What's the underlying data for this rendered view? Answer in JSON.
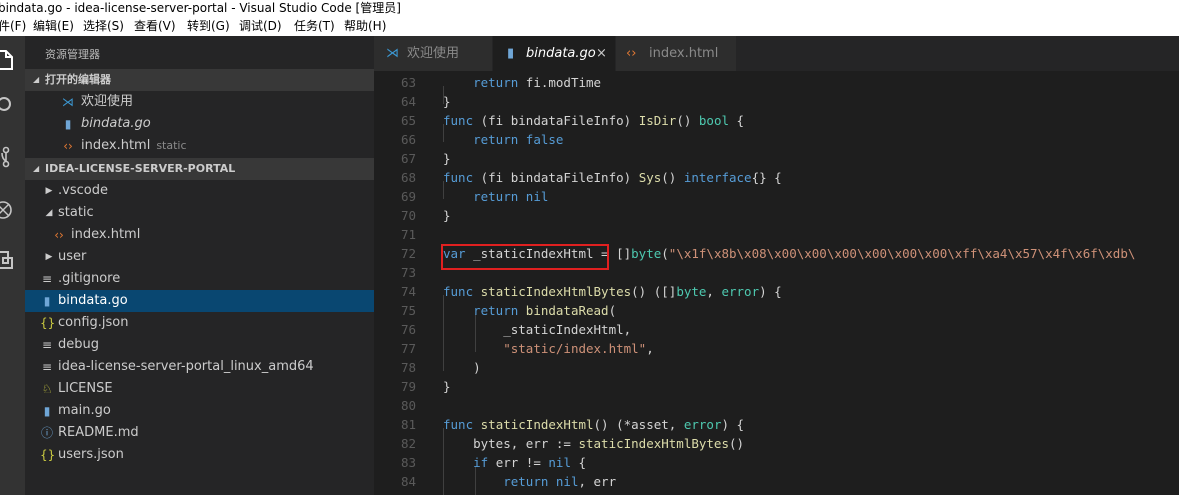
{
  "window": {
    "title": "bindata.go - idea-license-server-portal - Visual Studio Code [管理员]"
  },
  "menu": [
    "件(F)",
    "编辑(E)",
    "选择(S)",
    "查看(V)",
    "转到(G)",
    "调试(D)",
    "任务(T)",
    "帮助(H)"
  ],
  "activity_bar": [
    "files-icon",
    "search-icon",
    "source-control-icon",
    "debug-icon",
    "extensions-icon"
  ],
  "sidebar": {
    "title": "资源管理器",
    "open_editors": {
      "label": "打开的编辑器",
      "items": [
        {
          "name": "欢迎使用",
          "icon": "vscode-icon"
        },
        {
          "name": "bindata.go",
          "icon": "go-icon"
        },
        {
          "name": "index.html",
          "icon": "html-icon",
          "desc": "static"
        }
      ]
    },
    "project": {
      "label": "IDEA-LICENSE-SERVER-PORTAL",
      "items": [
        {
          "name": ".vscode",
          "type": "folder",
          "expanded": false
        },
        {
          "name": "static",
          "type": "folder",
          "expanded": true
        },
        {
          "name": "index.html",
          "type": "html"
        },
        {
          "name": "user",
          "type": "folder",
          "expanded": false
        },
        {
          "name": ".gitignore",
          "type": "file"
        },
        {
          "name": "bindata.go",
          "type": "go",
          "selected": true
        },
        {
          "name": "config.json",
          "type": "json"
        },
        {
          "name": "debug",
          "type": "file"
        },
        {
          "name": "idea-license-server-portal_linux_amd64",
          "type": "file"
        },
        {
          "name": "LICENSE",
          "type": "license"
        },
        {
          "name": "main.go",
          "type": "go"
        },
        {
          "name": "README.md",
          "type": "info"
        },
        {
          "name": "users.json",
          "type": "json"
        }
      ]
    }
  },
  "tabs": [
    {
      "label": "欢迎使用",
      "icon": "vscode-icon"
    },
    {
      "label": "bindata.go",
      "icon": "go-icon",
      "active": true,
      "close": "×"
    },
    {
      "label": "index.html",
      "icon": "html-icon"
    }
  ],
  "editor": {
    "highlight_color": "#e02020",
    "line_numbers": [
      "63",
      "64",
      "65",
      "66",
      "67",
      "68",
      "69",
      "70",
      "71",
      "72",
      "73",
      "74",
      "75",
      "76",
      "77",
      "78",
      "79",
      "80",
      "81",
      "82",
      "83",
      "84"
    ],
    "lines": [
      "    return fi.modTime",
      "}",
      "func (fi bindataFileInfo) IsDir() bool {",
      "    return false",
      "}",
      "func (fi bindataFileInfo) Sys() interface{} {",
      "    return nil",
      "}",
      "",
      "var _staticIndexHtml = []byte(\"\\x1f\\x8b\\x08\\x00\\x00\\x00\\x00\\x00\\x00\\xff\\xa4\\x57\\x4f\\x6f\\xdb\\",
      "",
      "func staticIndexHtmlBytes() ([]byte, error) {",
      "    return bindataRead(",
      "        _staticIndexHtml,",
      "        \"static/index.html\",",
      "    )",
      "}",
      "",
      "func staticIndexHtml() (*asset, error) {",
      "    bytes, err := staticIndexHtmlBytes()",
      "    if err != nil {",
      "        return nil, err"
    ]
  }
}
